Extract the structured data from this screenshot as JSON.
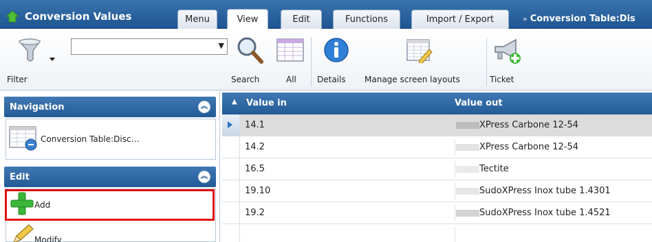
{
  "app": {
    "title": "Conversion Values",
    "tabs": [
      "Menu",
      "View",
      "Edit",
      "Functions",
      "Import / Export"
    ],
    "breadcrumb": "Conversion Table:Dis"
  },
  "toolbar": {
    "filter_label": "Filter",
    "search_label": "Search",
    "all_label": "All",
    "details_label": "Details",
    "manage_layouts_label": "Manage screen layouts",
    "ticket_label": "Ticket",
    "combo_value": ""
  },
  "left": {
    "navigation_header": "Navigation",
    "nav_item": "Conversion Table:Disc…",
    "edit_header": "Edit",
    "add_label": "Add",
    "modify_label": "Modify"
  },
  "grid": {
    "col_value_in": "Value in",
    "col_value_out": "Value out",
    "rows": [
      {
        "in": "14.1",
        "out": "XPress Carbone 12-54"
      },
      {
        "in": "14.2",
        "out": "XPress Carbone 12-54"
      },
      {
        "in": "16.5",
        "out": "Tectite"
      },
      {
        "in": "19.10",
        "out": "SudoXPress Inox tube 1.4301"
      },
      {
        "in": "19.2",
        "out": "SudoXPress Inox tube 1.4521"
      }
    ]
  },
  "colors": {
    "header_blue": "#235b97",
    "highlight_red": "#e01010"
  }
}
